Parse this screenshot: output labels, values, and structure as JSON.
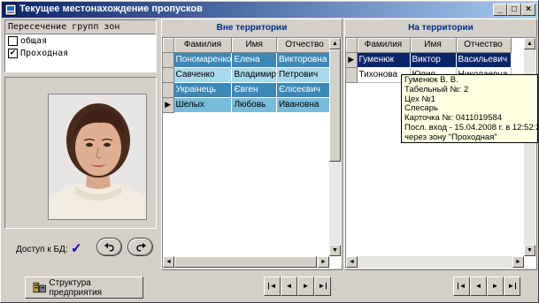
{
  "window": {
    "title": "Текущее местонахождение пропусков"
  },
  "zones": {
    "header": "Пересечение групп зон",
    "items": [
      {
        "label": "общая",
        "checked": false
      },
      {
        "label": "Проходная",
        "checked": true
      }
    ]
  },
  "db": {
    "label": "Доступ к БД:",
    "status": "✓"
  },
  "buttons": {
    "structure": "Структура предприятия"
  },
  "outside": {
    "title": "Вне территории",
    "columns": [
      "Фамилия",
      "Имя",
      "Отчество"
    ],
    "rows": [
      {
        "last": "Пономаренко",
        "first": "Елена",
        "middle": "Викторовна"
      },
      {
        "last": "Савченко",
        "first": "Владимир",
        "middle": "Петрович"
      },
      {
        "last": "Украінець",
        "first": "Євген",
        "middle": "Єлісеєвич"
      },
      {
        "last": "Шелых",
        "first": "Любовь",
        "middle": "Ивановна"
      }
    ]
  },
  "inside": {
    "title": "На территории",
    "columns": [
      "Фамилия",
      "Имя",
      "Отчество"
    ],
    "rows": [
      {
        "last": "Гуменюк",
        "first": "Виктор",
        "middle": "Васильевич"
      },
      {
        "last": "Тихонова",
        "first": "Юлия",
        "middle": "Николаевна"
      }
    ]
  },
  "tooltip": {
    "lines": [
      "Гуменюк В. В.",
      "Табельный №: 2",
      "Цех №1",
      "Слесарь",
      "Карточка №: 0411019584",
      "Посл. вход - 15.04.2008 г. в 12:52:21",
      "через зону \"Проходная\""
    ]
  },
  "nav": {
    "first": "|◄",
    "prev": "◄",
    "next": "►",
    "last": "►|"
  }
}
